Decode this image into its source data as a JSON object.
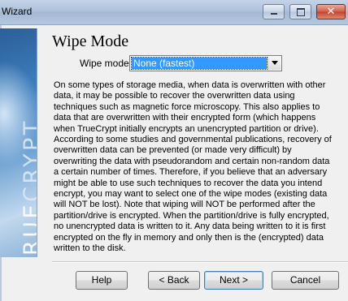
{
  "window": {
    "title": "Wizard",
    "close_glyph": "✕"
  },
  "banner": {
    "text_part1": "TRUE",
    "text_part2": "CRYPT"
  },
  "page": {
    "heading": "Wipe Mode",
    "wipe_mode_label": "Wipe mode:",
    "wipe_mode_value": "None (fastest)",
    "description": "On some types of storage media, when data is overwritten with other data, it may be possible to recover the overwritten data using techniques such as magnetic force microscopy. This also applies to data that are overwritten with their encrypted form (which happens when TrueCrypt initially encrypts an unencrypted partition or drive). According to some studies and governmental publications, recovery of overwritten data can be prevented (or made very difficult) by overwriting the data with pseudorandom and certain non-random data a certain number of times. Therefore, if you believe that an adversary might be able to use such techniques to recover the data you intend encrypt, you may want to select one of the wipe modes (existing data will NOT be lost). Note that wiping will NOT be performed after the partition/drive is encrypted. When the partition/drive is fully encrypted, no unencrypted data is written to it. Any data being written to it is first encrypted on the fly in memory and only then is the (encrypted) data written to the disk."
  },
  "buttons": {
    "help": "Help",
    "back": "< Back",
    "next": "Next >",
    "cancel": "Cancel"
  },
  "icons": {
    "minimize": "minimize-icon",
    "maximize": "maximize-icon",
    "close": "close-icon",
    "dropdown": "chevron-down-icon"
  },
  "colors": {
    "selection": "#3399ff",
    "close_button": "#c3422a"
  }
}
